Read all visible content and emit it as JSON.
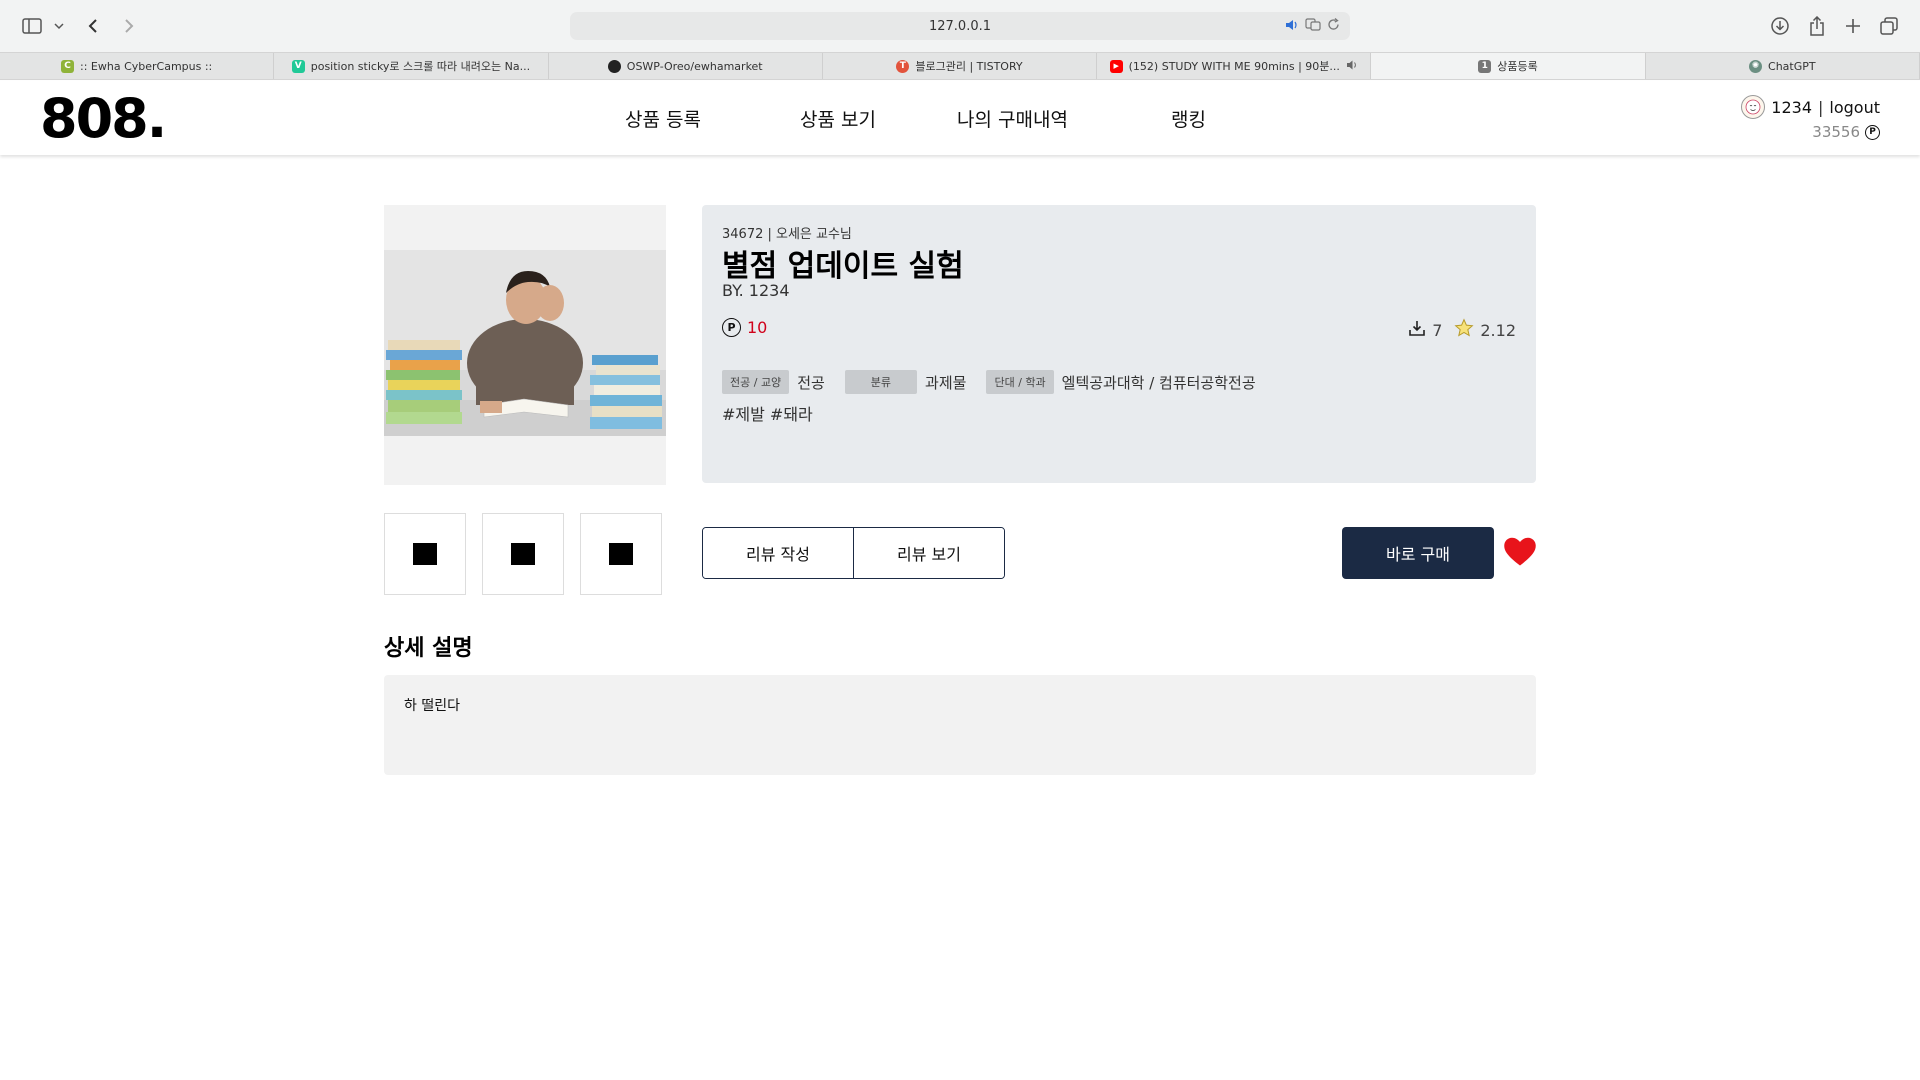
{
  "browser": {
    "url": "127.0.0.1",
    "tabs": [
      {
        "label": ":: Ewha CyberCampus ::",
        "icon": "cybercampus-favicon",
        "color": "#8fb339",
        "glyph": "C"
      },
      {
        "label": "position sticky로 스크롤 따라 내려오는 Na...",
        "icon": "velog-favicon",
        "color": "#20c997",
        "glyph": "V"
      },
      {
        "label": "OSWP-Oreo/ewhamarket",
        "icon": "github-favicon",
        "color": "#222222",
        "glyph": "●"
      },
      {
        "label": "블로그관리 | TISTORY",
        "icon": "tistory-favicon",
        "color": "#e2533c",
        "glyph": "T"
      },
      {
        "label": "(152) STUDY WITH ME 90mins | 90분...",
        "icon": "youtube-favicon",
        "color": "#ff0000",
        "glyph": "▶"
      },
      {
        "label": "상품등록",
        "icon": "page-favicon",
        "color": "#777777",
        "glyph": "1"
      },
      {
        "label": "ChatGPT",
        "icon": "chatgpt-favicon",
        "color": "#6b8f82",
        "glyph": "✺"
      }
    ],
    "active_tab_index": 5
  },
  "header": {
    "logo": "808.",
    "nav": [
      "상품 등록",
      "상품 보기",
      "나의 구매내역",
      "랭킹"
    ],
    "user": {
      "name": "1234",
      "logout": "logout",
      "points": "33556",
      "point_symbol": "P"
    }
  },
  "product": {
    "course": "34672 | 오세은 교수님",
    "title": "별점 업데이트 실험",
    "author": "BY. 1234",
    "price": "10",
    "downloads": "7",
    "rating": "2.12",
    "tags": [
      {
        "label": "전공 / 교양",
        "value": "전공"
      },
      {
        "label": "분류",
        "value": "과제물"
      },
      {
        "label": "단대 / 학과",
        "value": "엘텍공과대학 / 컴퓨터공학전공"
      }
    ],
    "hashtags": "#제발 #돼라",
    "liked": true
  },
  "actions": {
    "write_review": "리뷰 작성",
    "view_review": "리뷰 보기",
    "buy": "바로 구매"
  },
  "detail": {
    "heading": "상세 설명",
    "body": "하 떨린다"
  },
  "colors": {
    "accent": "#1b2a44",
    "price": "#d0021b",
    "heart": "#e8141b",
    "panel": "#e8ebee"
  }
}
